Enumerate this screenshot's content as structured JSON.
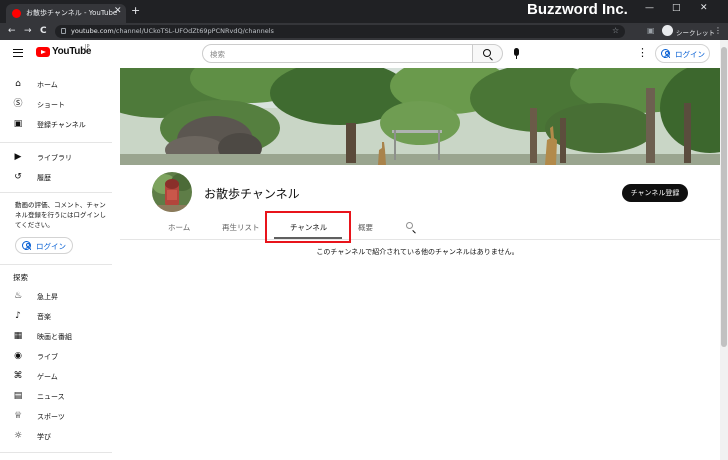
{
  "browser": {
    "tab_title": "お散歩チャンネル - YouTube",
    "tab_close": "✕",
    "new_tab": "+",
    "url_domain": "youtube.com",
    "url_path": "/channel/UCkoTSL-UFOdZt69pPCNRvdQ/channels",
    "secret_label": "シークレット",
    "nav": {
      "back": "←",
      "forward": "→",
      "reload": "C"
    },
    "window_controls": {
      "minimize": "—",
      "maximize": "□",
      "close": "✕"
    },
    "menu": "⋮"
  },
  "watermark": "Buzzword Inc.",
  "header": {
    "logo_text": "YouTube",
    "logo_region": "JP",
    "search_placeholder": "検索",
    "more": "⋮",
    "login_label": "ログイン"
  },
  "sidebar": {
    "items_top": [
      {
        "label": "ホーム",
        "icon": "home-icon",
        "glyph": "⌂"
      },
      {
        "label": "ショート",
        "icon": "shorts-icon",
        "glyph": "Ⓢ"
      },
      {
        "label": "登録チャンネル",
        "icon": "subscriptions-icon",
        "glyph": "▣"
      }
    ],
    "items_mid": [
      {
        "label": "ライブラリ",
        "icon": "library-icon",
        "glyph": "▶"
      },
      {
        "label": "履歴",
        "icon": "history-icon",
        "glyph": "↺"
      }
    ],
    "note": "動画の評価、コメント、チャンネル登録を行うにはログインしてください。",
    "login_label": "ログイン",
    "explore_heading": "探索",
    "items_explore": [
      {
        "label": "急上昇",
        "icon": "trending-icon",
        "glyph": "♨"
      },
      {
        "label": "音楽",
        "icon": "music-icon",
        "glyph": "♪"
      },
      {
        "label": "映画と番組",
        "icon": "movies-icon",
        "glyph": "▦"
      },
      {
        "label": "ライブ",
        "icon": "live-icon",
        "glyph": "◉"
      },
      {
        "label": "ゲーム",
        "icon": "gaming-icon",
        "glyph": "⌘"
      },
      {
        "label": "ニュース",
        "icon": "news-icon",
        "glyph": "▤"
      },
      {
        "label": "スポーツ",
        "icon": "sports-icon",
        "glyph": "♕"
      },
      {
        "label": "学び",
        "icon": "learning-icon",
        "glyph": "☼"
      }
    ]
  },
  "channel": {
    "name": "お散歩チャンネル",
    "subscribe_label": "チャンネル登録",
    "tabs": [
      {
        "label": "ホーム"
      },
      {
        "label": "再生リスト"
      },
      {
        "label": "チャンネル",
        "active": true
      },
      {
        "label": "概要"
      }
    ],
    "empty_message": "このチャンネルで紹介されている他のチャンネルはありません。"
  },
  "colors": {
    "brand_red": "#ff0000",
    "link_blue": "#065fd4",
    "highlight_red": "#e8141b",
    "chrome_dark": "#202124"
  }
}
